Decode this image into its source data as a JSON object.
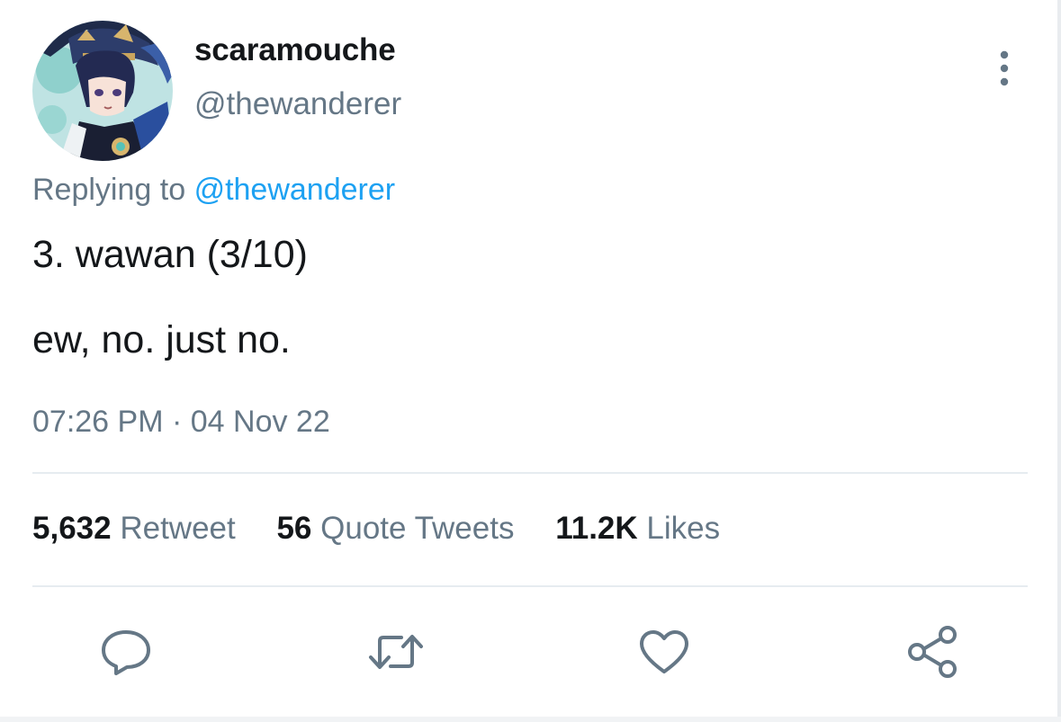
{
  "user": {
    "display_name": "scaramouche",
    "handle": "@thewanderer"
  },
  "reply": {
    "prefix": "Replying to",
    "mention": "@thewanderer"
  },
  "tweet": {
    "lines": [
      "3. wawan (3/10)",
      "ew, no. just no."
    ],
    "timestamp": "07:26 PM · 04 Nov 22"
  },
  "stats": {
    "retweets": {
      "count": "5,632",
      "label": "Retweet"
    },
    "quotes": {
      "count": "56",
      "label": "Quote Tweets"
    },
    "likes": {
      "count": "11.2K",
      "label": "Likes"
    }
  },
  "icons": {
    "more": "more-vertical-icon",
    "reply": "reply-icon",
    "retweet": "retweet-icon",
    "like": "heart-icon",
    "share": "share-icon"
  },
  "colors": {
    "text": "#14171a",
    "secondary": "#657786",
    "accent": "#1da1f2",
    "divider": "#e6ecf0"
  }
}
